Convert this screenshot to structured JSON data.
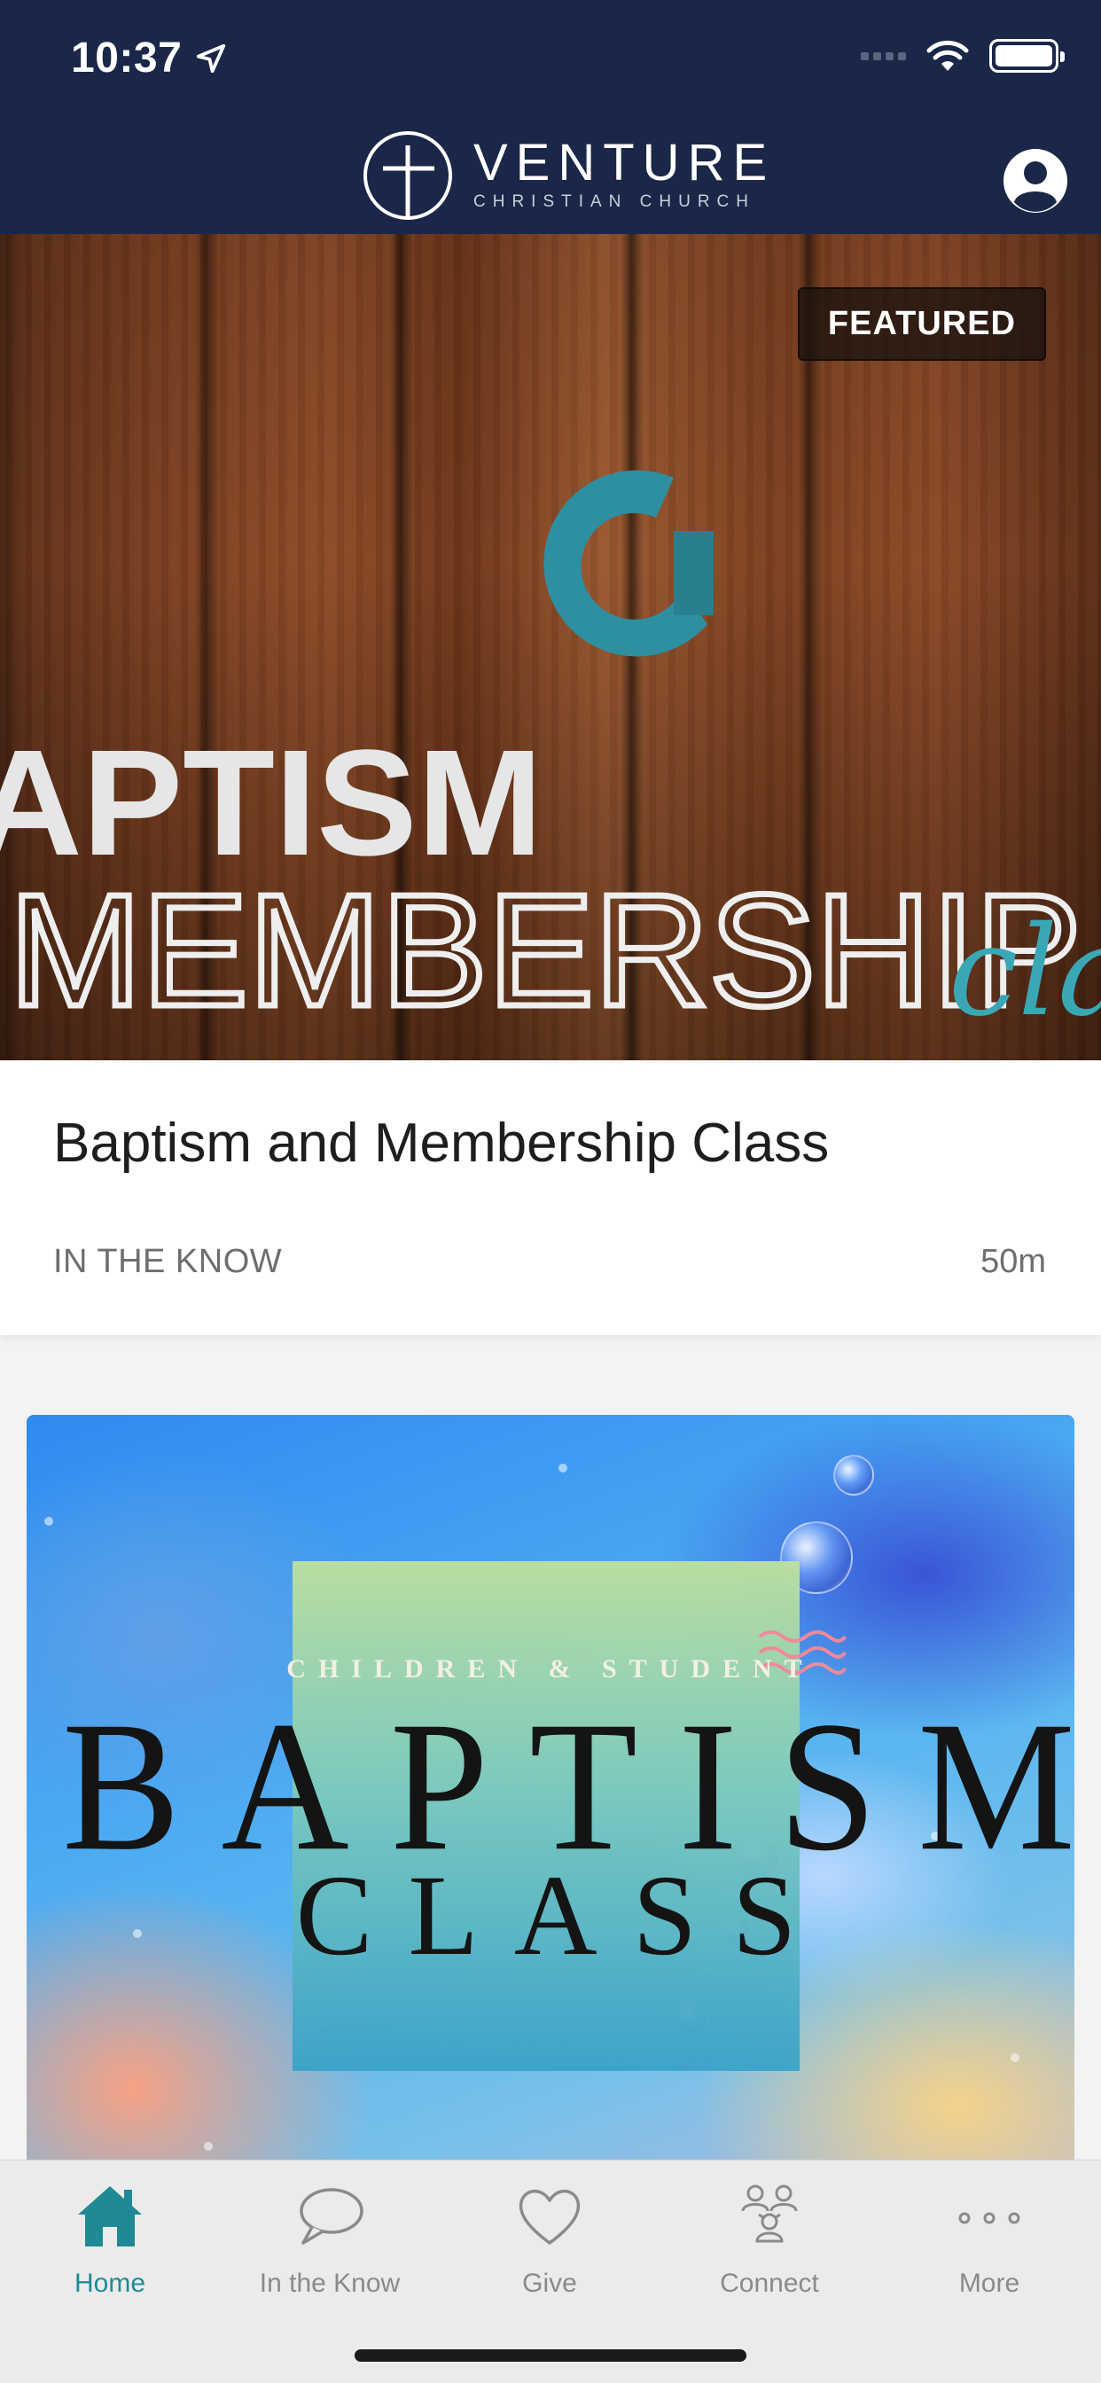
{
  "status_bar": {
    "time": "10:37"
  },
  "header": {
    "brand_name": "VENTURE",
    "brand_sub": "CHRISTIAN CHURCH"
  },
  "featured": {
    "badge": "FEATURED",
    "art_line1": "APTISM",
    "art_line2": "MEMBERSHIP",
    "art_script": "cla",
    "title": "Baptism and Membership Class",
    "category": "IN THE KNOW",
    "duration": "50m"
  },
  "card2": {
    "subtitle": "CHILDREN & STUDENT",
    "main": "BAPTISM",
    "class": "CLASS"
  },
  "tabs": [
    {
      "label": "Home",
      "icon": "home-icon",
      "active": true
    },
    {
      "label": "In the Know",
      "icon": "chat-bubble-icon"
    },
    {
      "label": "Give",
      "icon": "heart-icon"
    },
    {
      "label": "Connect",
      "icon": "group-icon"
    },
    {
      "label": "More",
      "icon": "more-dots-icon"
    }
  ],
  "colors": {
    "header_bg": "#1b2748",
    "accent": "#1f8a95",
    "tabbar_bg": "#ebebeb"
  }
}
